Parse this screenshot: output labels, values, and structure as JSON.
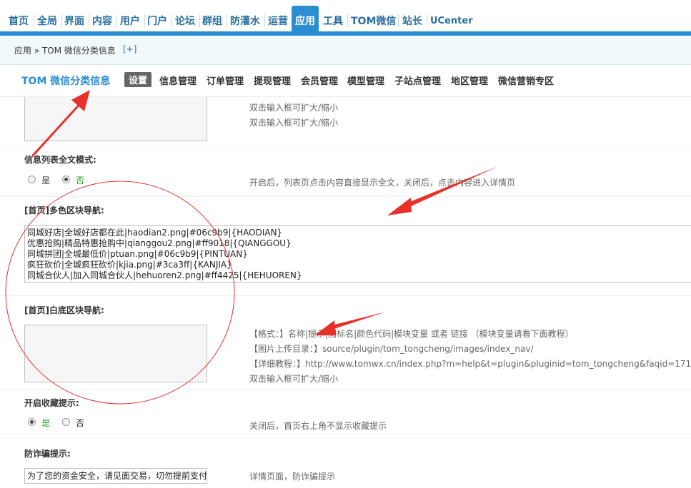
{
  "nav": [
    "首页",
    "全局",
    "界面",
    "内容",
    "用户",
    "门户",
    "论坛",
    "群组",
    "防灌水",
    "运营",
    "应用",
    "工具",
    "TOM微信",
    "站长",
    "UCenter"
  ],
  "breadcrumb": {
    "path": "应用 » TOM 微信分类信息",
    "add": "[+]"
  },
  "plugin": {
    "title": "TOM 微信分类信息",
    "tabs": [
      "设置",
      "信息管理",
      "订单管理",
      "提现管理",
      "会员管理",
      "模型管理",
      "子站点管理",
      "地区管理",
      "微信营销专区"
    ]
  },
  "section0": {
    "desc1": "双击输入框可扩大/缩小",
    "desc2": "双击输入框可扩大/缩小"
  },
  "section1": {
    "label": "信息列表全文模式:",
    "opt_yes": "是",
    "opt_no": "否",
    "desc": "开启后，列表页点击内容直接显示全文，关闭后，点击内容进入详情页"
  },
  "section2": {
    "label": "[首页]多色区块导航:",
    "lines": [
      "同城好店|全城好店都在此|haodian2.png|#06c9b9|{HAODIAN}",
      "优惠抢购|精品特惠抢购中|qianggou2.png|#ff9018|{QIANGGOU}",
      "同城拼团|全城最低价|ptuan.png|#06c9b9|{PINTUAN}",
      "疯狂砍价|全城疯狂砍价|kjia.png|#3ca3ff|{KANJIA}",
      "同城合伙人|加入同城合伙人|hehuoren2.png|#ff4425|{HEHUOREN}"
    ]
  },
  "section3": {
    "label": "[首页]白底区块导航:",
    "desc1": "【格式：】名称|提示|图标名|颜色代码|模块变量 或者 链接 （模块变量请看下面教程）",
    "desc2": "【图片上传目录：】source/plugin/tom_tongcheng/images/index_nav/",
    "desc3": "【详细教程：】http://www.tomwx.cn/index.php?m=help&t=plugin&pluginid=tom_tongcheng&faqid=171",
    "desc4": "双击输入框可扩大/缩小"
  },
  "section4": {
    "label": "开启收藏提示:",
    "opt_yes": "是",
    "opt_no": "否",
    "desc": "关闭后，首页右上角不显示收藏提示"
  },
  "section5": {
    "label": "防诈骗提示:",
    "value": "为了您的资金安全，请见面交易，切勿提前支付",
    "desc": "详情页面，防诈骗提示"
  },
  "colors": {
    "accent": "#2b8ed3",
    "annotation": "#e8302a"
  }
}
